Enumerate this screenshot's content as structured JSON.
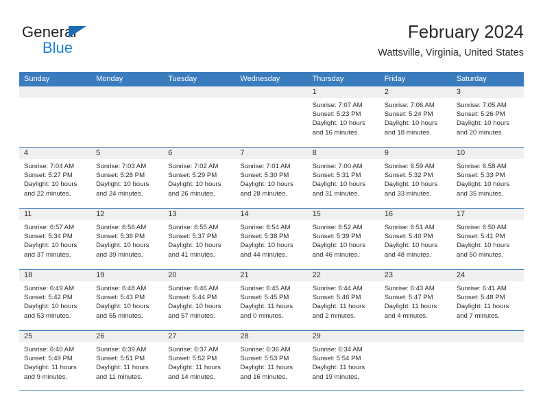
{
  "brand": {
    "name_top": "General",
    "name_bottom": "Blue",
    "accent_color": "#1b7fd4",
    "triangle_color": "#1b6cb5"
  },
  "header": {
    "title": "February 2024",
    "subtitle": "Wattsville, Virginia, United States"
  },
  "theme": {
    "header_blue": "#3a7cbe",
    "band_gray": "#f0f0f0",
    "text": "#2b2b2b"
  },
  "weekdays": [
    "Sunday",
    "Monday",
    "Tuesday",
    "Wednesday",
    "Thursday",
    "Friday",
    "Saturday"
  ],
  "weeks": [
    [
      {
        "day": "",
        "lines": []
      },
      {
        "day": "",
        "lines": []
      },
      {
        "day": "",
        "lines": []
      },
      {
        "day": "",
        "lines": []
      },
      {
        "day": "1",
        "lines": [
          "Sunrise: 7:07 AM",
          "Sunset: 5:23 PM",
          "Daylight: 10 hours",
          "and 16 minutes."
        ]
      },
      {
        "day": "2",
        "lines": [
          "Sunrise: 7:06 AM",
          "Sunset: 5:24 PM",
          "Daylight: 10 hours",
          "and 18 minutes."
        ]
      },
      {
        "day": "3",
        "lines": [
          "Sunrise: 7:05 AM",
          "Sunset: 5:26 PM",
          "Daylight: 10 hours",
          "and 20 minutes."
        ]
      }
    ],
    [
      {
        "day": "4",
        "lines": [
          "Sunrise: 7:04 AM",
          "Sunset: 5:27 PM",
          "Daylight: 10 hours",
          "and 22 minutes."
        ]
      },
      {
        "day": "5",
        "lines": [
          "Sunrise: 7:03 AM",
          "Sunset: 5:28 PM",
          "Daylight: 10 hours",
          "and 24 minutes."
        ]
      },
      {
        "day": "6",
        "lines": [
          "Sunrise: 7:02 AM",
          "Sunset: 5:29 PM",
          "Daylight: 10 hours",
          "and 26 minutes."
        ]
      },
      {
        "day": "7",
        "lines": [
          "Sunrise: 7:01 AM",
          "Sunset: 5:30 PM",
          "Daylight: 10 hours",
          "and 28 minutes."
        ]
      },
      {
        "day": "8",
        "lines": [
          "Sunrise: 7:00 AM",
          "Sunset: 5:31 PM",
          "Daylight: 10 hours",
          "and 31 minutes."
        ]
      },
      {
        "day": "9",
        "lines": [
          "Sunrise: 6:59 AM",
          "Sunset: 5:32 PM",
          "Daylight: 10 hours",
          "and 33 minutes."
        ]
      },
      {
        "day": "10",
        "lines": [
          "Sunrise: 6:58 AM",
          "Sunset: 5:33 PM",
          "Daylight: 10 hours",
          "and 35 minutes."
        ]
      }
    ],
    [
      {
        "day": "11",
        "lines": [
          "Sunrise: 6:57 AM",
          "Sunset: 5:34 PM",
          "Daylight: 10 hours",
          "and 37 minutes."
        ]
      },
      {
        "day": "12",
        "lines": [
          "Sunrise: 6:56 AM",
          "Sunset: 5:36 PM",
          "Daylight: 10 hours",
          "and 39 minutes."
        ]
      },
      {
        "day": "13",
        "lines": [
          "Sunrise: 6:55 AM",
          "Sunset: 5:37 PM",
          "Daylight: 10 hours",
          "and 41 minutes."
        ]
      },
      {
        "day": "14",
        "lines": [
          "Sunrise: 6:54 AM",
          "Sunset: 5:38 PM",
          "Daylight: 10 hours",
          "and 44 minutes."
        ]
      },
      {
        "day": "15",
        "lines": [
          "Sunrise: 6:52 AM",
          "Sunset: 5:39 PM",
          "Daylight: 10 hours",
          "and 46 minutes."
        ]
      },
      {
        "day": "16",
        "lines": [
          "Sunrise: 6:51 AM",
          "Sunset: 5:40 PM",
          "Daylight: 10 hours",
          "and 48 minutes."
        ]
      },
      {
        "day": "17",
        "lines": [
          "Sunrise: 6:50 AM",
          "Sunset: 5:41 PM",
          "Daylight: 10 hours",
          "and 50 minutes."
        ]
      }
    ],
    [
      {
        "day": "18",
        "lines": [
          "Sunrise: 6:49 AM",
          "Sunset: 5:42 PM",
          "Daylight: 10 hours",
          "and 53 minutes."
        ]
      },
      {
        "day": "19",
        "lines": [
          "Sunrise: 6:48 AM",
          "Sunset: 5:43 PM",
          "Daylight: 10 hours",
          "and 55 minutes."
        ]
      },
      {
        "day": "20",
        "lines": [
          "Sunrise: 6:46 AM",
          "Sunset: 5:44 PM",
          "Daylight: 10 hours",
          "and 57 minutes."
        ]
      },
      {
        "day": "21",
        "lines": [
          "Sunrise: 6:45 AM",
          "Sunset: 5:45 PM",
          "Daylight: 11 hours",
          "and 0 minutes."
        ]
      },
      {
        "day": "22",
        "lines": [
          "Sunrise: 6:44 AM",
          "Sunset: 5:46 PM",
          "Daylight: 11 hours",
          "and 2 minutes."
        ]
      },
      {
        "day": "23",
        "lines": [
          "Sunrise: 6:43 AM",
          "Sunset: 5:47 PM",
          "Daylight: 11 hours",
          "and 4 minutes."
        ]
      },
      {
        "day": "24",
        "lines": [
          "Sunrise: 6:41 AM",
          "Sunset: 5:48 PM",
          "Daylight: 11 hours",
          "and 7 minutes."
        ]
      }
    ],
    [
      {
        "day": "25",
        "lines": [
          "Sunrise: 6:40 AM",
          "Sunset: 5:49 PM",
          "Daylight: 11 hours",
          "and 9 minutes."
        ]
      },
      {
        "day": "26",
        "lines": [
          "Sunrise: 6:39 AM",
          "Sunset: 5:51 PM",
          "Daylight: 11 hours",
          "and 11 minutes."
        ]
      },
      {
        "day": "27",
        "lines": [
          "Sunrise: 6:37 AM",
          "Sunset: 5:52 PM",
          "Daylight: 11 hours",
          "and 14 minutes."
        ]
      },
      {
        "day": "28",
        "lines": [
          "Sunrise: 6:36 AM",
          "Sunset: 5:53 PM",
          "Daylight: 11 hours",
          "and 16 minutes."
        ]
      },
      {
        "day": "29",
        "lines": [
          "Sunrise: 6:34 AM",
          "Sunset: 5:54 PM",
          "Daylight: 11 hours",
          "and 19 minutes."
        ]
      },
      {
        "day": "",
        "lines": []
      },
      {
        "day": "",
        "lines": []
      }
    ]
  ]
}
